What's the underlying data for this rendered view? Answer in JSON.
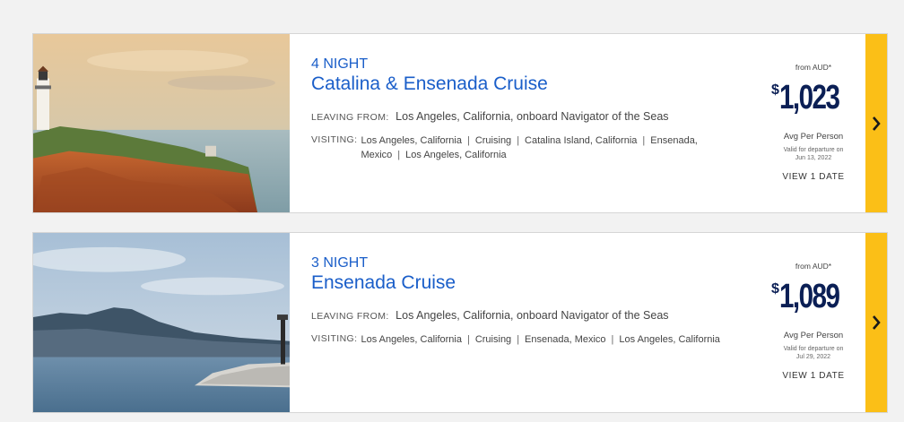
{
  "cruises": [
    {
      "nights": "4 NIGHT",
      "title": "Catalina & Ensenada Cruise",
      "leaving_label": "LEAVING FROM:",
      "leaving_value": "Los Angeles, California, onboard Navigator of the Seas",
      "visiting_label": "VISITING:",
      "ports": [
        "Los Angeles, California",
        "Cruising",
        "Catalina Island, California",
        "Ensenada, Mexico",
        "Los Angeles, California"
      ],
      "from_label": "from AUD*",
      "currency_symbol": "$",
      "price": "1,023",
      "avg_label": "Avg Per Person",
      "valid_label": "Valid for departure on",
      "valid_date": "Jun 13, 2022",
      "view_dates": "VIEW 1 DATE",
      "image": "lighthouse-cliff-photo",
      "arrow_icon": "chevron-right-icon"
    },
    {
      "nights": "3 NIGHT",
      "title": "Ensenada Cruise",
      "leaving_label": "LEAVING FROM:",
      "leaving_value": "Los Angeles, California, onboard Navigator of the Seas",
      "visiting_label": "VISITING:",
      "ports": [
        "Los Angeles, California",
        "Cruising",
        "Ensenada, Mexico",
        "Los Angeles, California"
      ],
      "from_label": "from AUD*",
      "currency_symbol": "$",
      "price": "1,089",
      "avg_label": "Avg Per Person",
      "valid_label": "Valid for departure on",
      "valid_date": "Jul 29, 2022",
      "view_dates": "VIEW 1 DATE",
      "image": "harbor-jetty-photo",
      "arrow_icon": "chevron-right-icon"
    }
  ],
  "colors": {
    "title_blue": "#1a5ec9",
    "price_navy": "#0b1f55",
    "accent_yellow": "#fbbf17",
    "page_bg": "#f2f2f2"
  }
}
